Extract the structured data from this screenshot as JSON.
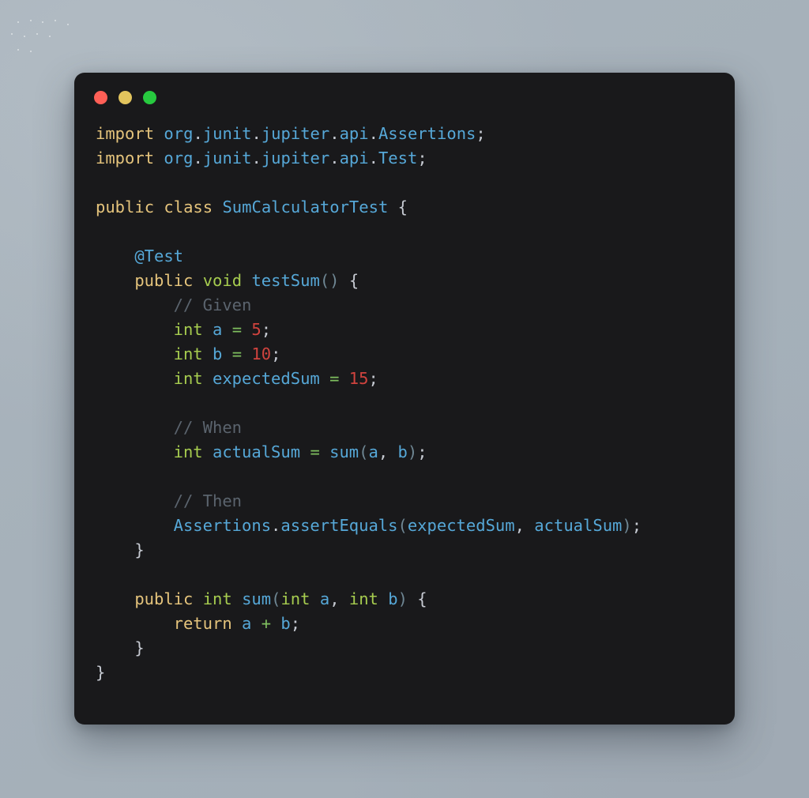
{
  "window": {
    "background_color": "#A8B3BC",
    "panel_color": "#19191B",
    "controls": [
      {
        "name": "close",
        "color": "#FF5F56"
      },
      {
        "name": "minimize",
        "color": "#E2C45D"
      },
      {
        "name": "maximize",
        "color": "#27C93F"
      }
    ]
  },
  "theme": {
    "keyword": "#E5C47C",
    "type": "#A6CC4F",
    "identifier": "#56A8D8",
    "number": "#D0433E",
    "operator": "#7FBF5F",
    "comment": "#5B646E",
    "punctuation": "#C6CAD2",
    "paren": "#6F8794"
  },
  "code": {
    "language": "java",
    "plain_text": "import org.junit.jupiter.api.Assertions;\nimport org.junit.jupiter.api.Test;\n\npublic class SumCalculatorTest {\n\n    @Test\n    public void testSum() {\n        // Given\n        int a = 5;\n        int b = 10;\n        int expectedSum = 15;\n\n        // When\n        int actualSum = sum(a, b);\n\n        // Then\n        Assertions.assertEquals(expectedSum, actualSum);\n    }\n\n    public int sum(int a, int b) {\n        return a + b;\n    }\n}",
    "lines": [
      {
        "indent": 0,
        "tokens": [
          {
            "t": "import",
            "c": "kw"
          },
          {
            "t": " ",
            "c": "pun"
          },
          {
            "t": "org",
            "c": "id"
          },
          {
            "t": ".",
            "c": "pun"
          },
          {
            "t": "junit",
            "c": "id"
          },
          {
            "t": ".",
            "c": "pun"
          },
          {
            "t": "jupiter",
            "c": "id"
          },
          {
            "t": ".",
            "c": "pun"
          },
          {
            "t": "api",
            "c": "id"
          },
          {
            "t": ".",
            "c": "pun"
          },
          {
            "t": "Assertions",
            "c": "id"
          },
          {
            "t": ";",
            "c": "pun"
          }
        ]
      },
      {
        "indent": 0,
        "tokens": [
          {
            "t": "import",
            "c": "kw"
          },
          {
            "t": " ",
            "c": "pun"
          },
          {
            "t": "org",
            "c": "id"
          },
          {
            "t": ".",
            "c": "pun"
          },
          {
            "t": "junit",
            "c": "id"
          },
          {
            "t": ".",
            "c": "pun"
          },
          {
            "t": "jupiter",
            "c": "id"
          },
          {
            "t": ".",
            "c": "pun"
          },
          {
            "t": "api",
            "c": "id"
          },
          {
            "t": ".",
            "c": "pun"
          },
          {
            "t": "Test",
            "c": "id"
          },
          {
            "t": ";",
            "c": "pun"
          }
        ]
      },
      {
        "indent": 0,
        "tokens": []
      },
      {
        "indent": 0,
        "tokens": [
          {
            "t": "public",
            "c": "kw"
          },
          {
            "t": " ",
            "c": "pun"
          },
          {
            "t": "class",
            "c": "kw"
          },
          {
            "t": " ",
            "c": "pun"
          },
          {
            "t": "SumCalculatorTest",
            "c": "id"
          },
          {
            "t": " ",
            "c": "pun"
          },
          {
            "t": "{",
            "c": "pun"
          }
        ]
      },
      {
        "indent": 0,
        "tokens": []
      },
      {
        "indent": 4,
        "tokens": [
          {
            "t": "@Test",
            "c": "id"
          }
        ]
      },
      {
        "indent": 4,
        "tokens": [
          {
            "t": "public",
            "c": "kw"
          },
          {
            "t": " ",
            "c": "pun"
          },
          {
            "t": "void",
            "c": "typ"
          },
          {
            "t": " ",
            "c": "pun"
          },
          {
            "t": "testSum",
            "c": "id"
          },
          {
            "t": "()",
            "c": "par"
          },
          {
            "t": " ",
            "c": "pun"
          },
          {
            "t": "{",
            "c": "pun"
          }
        ]
      },
      {
        "indent": 8,
        "tokens": [
          {
            "t": "// Given",
            "c": "com"
          }
        ]
      },
      {
        "indent": 8,
        "tokens": [
          {
            "t": "int",
            "c": "typ"
          },
          {
            "t": " ",
            "c": "pun"
          },
          {
            "t": "a",
            "c": "id"
          },
          {
            "t": " ",
            "c": "pun"
          },
          {
            "t": "=",
            "c": "op"
          },
          {
            "t": " ",
            "c": "pun"
          },
          {
            "t": "5",
            "c": "num"
          },
          {
            "t": ";",
            "c": "pun"
          }
        ]
      },
      {
        "indent": 8,
        "tokens": [
          {
            "t": "int",
            "c": "typ"
          },
          {
            "t": " ",
            "c": "pun"
          },
          {
            "t": "b",
            "c": "id"
          },
          {
            "t": " ",
            "c": "pun"
          },
          {
            "t": "=",
            "c": "op"
          },
          {
            "t": " ",
            "c": "pun"
          },
          {
            "t": "10",
            "c": "num"
          },
          {
            "t": ";",
            "c": "pun"
          }
        ]
      },
      {
        "indent": 8,
        "tokens": [
          {
            "t": "int",
            "c": "typ"
          },
          {
            "t": " ",
            "c": "pun"
          },
          {
            "t": "expectedSum",
            "c": "id"
          },
          {
            "t": " ",
            "c": "pun"
          },
          {
            "t": "=",
            "c": "op"
          },
          {
            "t": " ",
            "c": "pun"
          },
          {
            "t": "15",
            "c": "num"
          },
          {
            "t": ";",
            "c": "pun"
          }
        ]
      },
      {
        "indent": 0,
        "tokens": []
      },
      {
        "indent": 8,
        "tokens": [
          {
            "t": "// When",
            "c": "com"
          }
        ]
      },
      {
        "indent": 8,
        "tokens": [
          {
            "t": "int",
            "c": "typ"
          },
          {
            "t": " ",
            "c": "pun"
          },
          {
            "t": "actualSum",
            "c": "id"
          },
          {
            "t": " ",
            "c": "pun"
          },
          {
            "t": "=",
            "c": "op"
          },
          {
            "t": " ",
            "c": "pun"
          },
          {
            "t": "sum",
            "c": "id"
          },
          {
            "t": "(",
            "c": "par"
          },
          {
            "t": "a",
            "c": "id"
          },
          {
            "t": ",",
            "c": "pun"
          },
          {
            "t": " ",
            "c": "pun"
          },
          {
            "t": "b",
            "c": "id"
          },
          {
            "t": ")",
            "c": "par"
          },
          {
            "t": ";",
            "c": "pun"
          }
        ]
      },
      {
        "indent": 0,
        "tokens": []
      },
      {
        "indent": 8,
        "tokens": [
          {
            "t": "// Then",
            "c": "com"
          }
        ]
      },
      {
        "indent": 8,
        "tokens": [
          {
            "t": "Assertions",
            "c": "id"
          },
          {
            "t": ".",
            "c": "pun"
          },
          {
            "t": "assertEquals",
            "c": "id"
          },
          {
            "t": "(",
            "c": "par"
          },
          {
            "t": "expectedSum",
            "c": "id"
          },
          {
            "t": ",",
            "c": "pun"
          },
          {
            "t": " ",
            "c": "pun"
          },
          {
            "t": "actualSum",
            "c": "id"
          },
          {
            "t": ")",
            "c": "par"
          },
          {
            "t": ";",
            "c": "pun"
          }
        ]
      },
      {
        "indent": 4,
        "tokens": [
          {
            "t": "}",
            "c": "pun"
          }
        ]
      },
      {
        "indent": 0,
        "tokens": []
      },
      {
        "indent": 4,
        "tokens": [
          {
            "t": "public",
            "c": "kw"
          },
          {
            "t": " ",
            "c": "pun"
          },
          {
            "t": "int",
            "c": "typ"
          },
          {
            "t": " ",
            "c": "pun"
          },
          {
            "t": "sum",
            "c": "id"
          },
          {
            "t": "(",
            "c": "par"
          },
          {
            "t": "int",
            "c": "typ"
          },
          {
            "t": " ",
            "c": "pun"
          },
          {
            "t": "a",
            "c": "id"
          },
          {
            "t": ",",
            "c": "pun"
          },
          {
            "t": " ",
            "c": "pun"
          },
          {
            "t": "int",
            "c": "typ"
          },
          {
            "t": " ",
            "c": "pun"
          },
          {
            "t": "b",
            "c": "id"
          },
          {
            "t": ")",
            "c": "par"
          },
          {
            "t": " ",
            "c": "pun"
          },
          {
            "t": "{",
            "c": "pun"
          }
        ]
      },
      {
        "indent": 8,
        "tokens": [
          {
            "t": "return",
            "c": "kw"
          },
          {
            "t": " ",
            "c": "pun"
          },
          {
            "t": "a",
            "c": "id"
          },
          {
            "t": " ",
            "c": "pun"
          },
          {
            "t": "+",
            "c": "op"
          },
          {
            "t": " ",
            "c": "pun"
          },
          {
            "t": "b",
            "c": "id"
          },
          {
            "t": ";",
            "c": "pun"
          }
        ]
      },
      {
        "indent": 4,
        "tokens": [
          {
            "t": "}",
            "c": "pun"
          }
        ]
      },
      {
        "indent": 0,
        "tokens": [
          {
            "t": "}",
            "c": "pun"
          }
        ]
      }
    ]
  }
}
